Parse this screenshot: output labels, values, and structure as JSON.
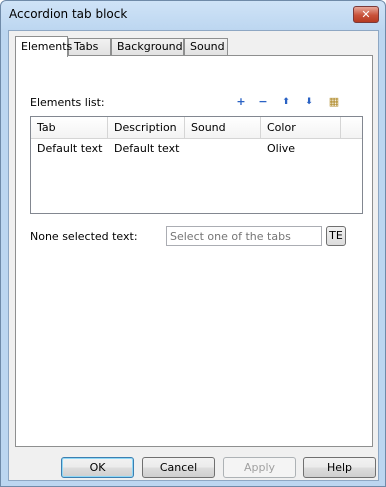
{
  "window": {
    "title": "Accordion tab block",
    "close_label": "✕"
  },
  "tabs": [
    {
      "label": "Elements",
      "active": true
    },
    {
      "label": "Tabs",
      "active": false
    },
    {
      "label": "Background",
      "active": false
    },
    {
      "label": "Sound",
      "active": false
    }
  ],
  "elements_list": {
    "label": "Elements list:",
    "toolbar": [
      {
        "icon": "add-icon",
        "glyph": "+"
      },
      {
        "icon": "remove-icon",
        "glyph": "−"
      },
      {
        "icon": "move-up-icon",
        "glyph": "⬆"
      },
      {
        "icon": "move-down-icon",
        "glyph": "⬇"
      },
      {
        "icon": "properties-icon",
        "glyph": "▦"
      }
    ],
    "columns": [
      "Tab",
      "Description",
      "Sound",
      "Color"
    ],
    "rows": [
      {
        "tab": "Default text",
        "description": "Default text",
        "sound": "",
        "color": "Olive"
      }
    ]
  },
  "none_selected": {
    "label": "None selected text:",
    "placeholder": "Select one of the tabs",
    "te_label": "TE"
  },
  "buttons": {
    "ok": "OK",
    "cancel": "Cancel",
    "apply": "Apply",
    "help": "Help"
  }
}
